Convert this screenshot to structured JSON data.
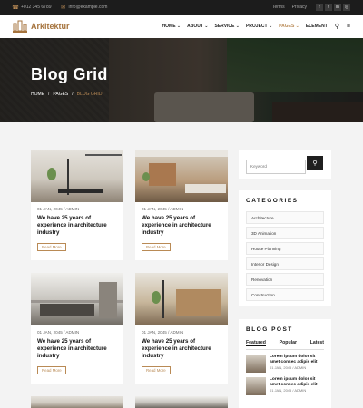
{
  "topbar": {
    "phone": "+012 345 6789",
    "email": "info@example.com",
    "links": [
      "Terms",
      "Privacy"
    ],
    "social": [
      {
        "icon": "facebook-icon",
        "glyph": "f"
      },
      {
        "icon": "twitter-icon",
        "glyph": "t"
      },
      {
        "icon": "linkedin-icon",
        "glyph": "in"
      },
      {
        "icon": "instagram-icon",
        "glyph": "◎"
      }
    ]
  },
  "brand": {
    "name": "Arkitektur",
    "accent": "#b98a55"
  },
  "menu": [
    {
      "label": "HOME ⌄",
      "active": false
    },
    {
      "label": "ABOUT ⌄",
      "active": false
    },
    {
      "label": "SERVICE ⌄",
      "active": false
    },
    {
      "label": "PROJECT ⌄",
      "active": false
    },
    {
      "label": "PAGES ⌄",
      "active": true
    },
    {
      "label": "ELEMENT",
      "active": false
    }
  ],
  "hero": {
    "title": "Blog Grid",
    "breadcrumb": [
      "HOME",
      "/",
      "PAGES",
      "/",
      "BLOG GRID"
    ]
  },
  "posts": [
    {
      "meta": "01 JAN, 2045  /  ADMIN",
      "title": "We have 25 years of experience in architecture industry",
      "button": "Read More"
    },
    {
      "meta": "01 JAN, 2045  /  ADMIN",
      "title": "We have 25 years of experience in architecture industry",
      "button": "Read More"
    },
    {
      "meta": "01 JAN, 2045  /  ADMIN",
      "title": "We have 25 years of experience in architecture industry",
      "button": "Read More"
    },
    {
      "meta": "01 JAN, 2045  /  ADMIN",
      "title": "We have 25 years of experience in architecture industry",
      "button": "Read More"
    }
  ],
  "search": {
    "placeholder": "Keyword",
    "icon": "search-icon"
  },
  "categories": {
    "title": "CATEGORIES",
    "items": [
      "Architecture",
      "3D Animation",
      "House Planning",
      "Interior Design",
      "Renovation",
      "Construction"
    ]
  },
  "blog_post": {
    "title": "BLOG POST",
    "tabs": [
      "Featured",
      "Popular",
      "Latest"
    ],
    "items": [
      {
        "title": "Lorem ipsum dolor sit amet consec adipis elit",
        "meta": "01 JAN, 2045  /  ADMIN"
      },
      {
        "title": "Lorem ipsum dolor sit amet consec adipis elit",
        "meta": "01 JAN, 2045  /  ADMIN"
      }
    ]
  }
}
